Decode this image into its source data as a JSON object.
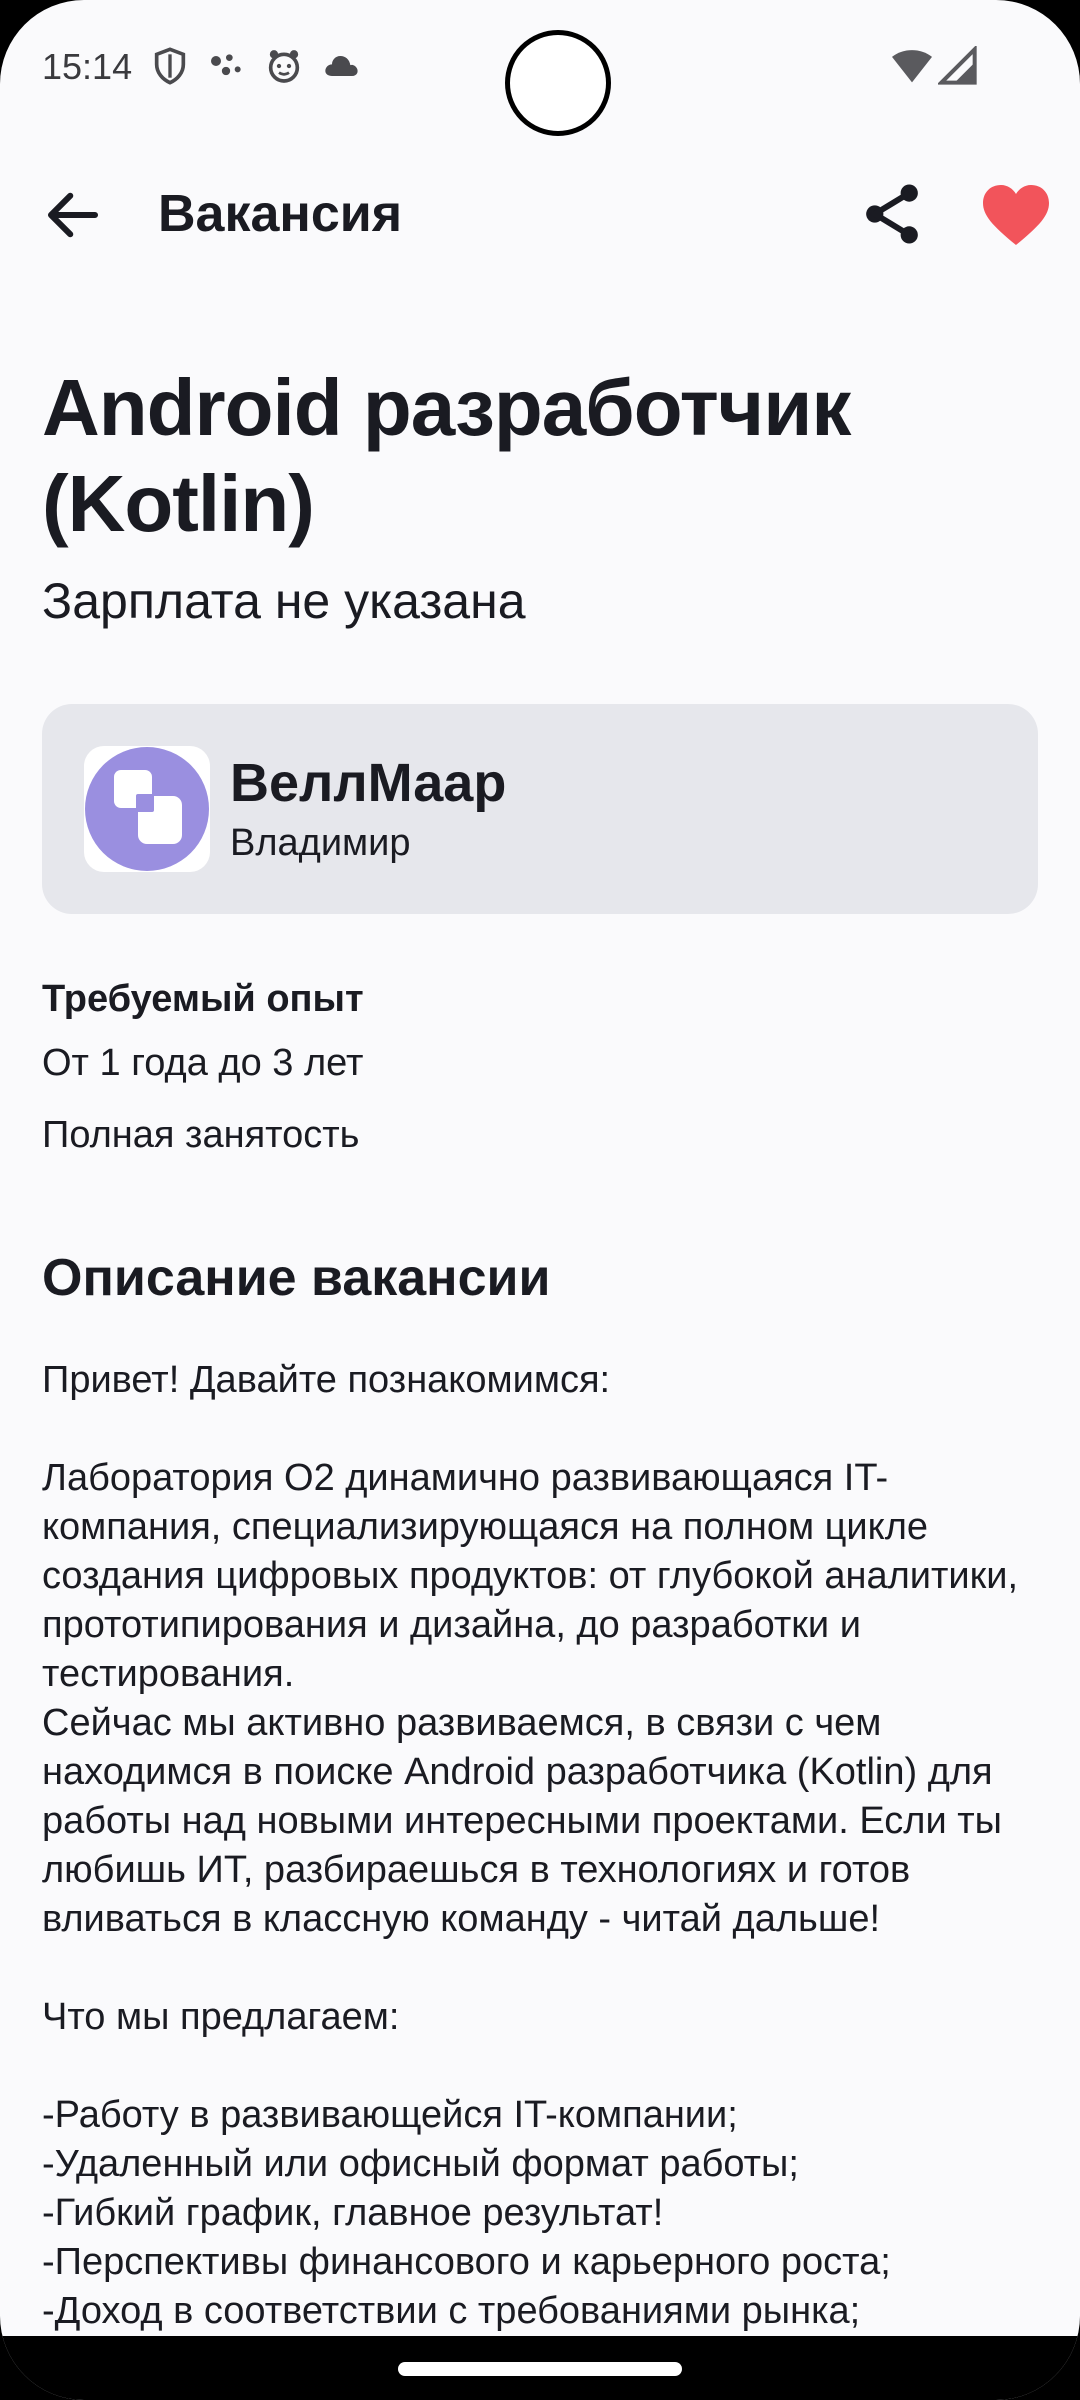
{
  "status_bar": {
    "time": "15:14",
    "icons": [
      "shield-icon",
      "assistant-dots-icon",
      "bear-face-icon",
      "cloud-icon",
      "wifi-icon",
      "signal-icon"
    ]
  },
  "top_bar": {
    "title": "Вакансия",
    "icons": [
      "back-arrow-icon",
      "share-icon",
      "heart-icon"
    ],
    "favorite_color": "#f2545b"
  },
  "vacancy": {
    "title": "Android разработчик (Kotlin)",
    "salary": "Зарплата не указана",
    "company": {
      "name": "ВеллМаар",
      "city": "Владимир",
      "logo_color": "#9a8fe0"
    },
    "experience_label": "Требуемый опыт",
    "experience_value": "От 1 года до 3 лет",
    "employment": "Полная занятость",
    "description_heading": "Описание вакансии",
    "description": "Привет! Давайте познакомимся:\n\nЛаборатория О2 динамично развивающаяся IT-компания, специализирующаяся на полном цикле создания цифровых продуктов: от глубокой аналитики, прототипирования и дизайна, до разработки и тестирования.\nСейчас мы активно развиваемся, в связи с чем находимся в поиске Android разработчика (Kotlin) для работы над новыми интересными проектами. Если ты любишь ИТ, разбираешься в технологиях и готов вливаться в классную команду - читай дальше!\n\nЧто мы предлагаем:\n\n-Работу в развивающейся IT-компании;\n-Удаленный или офисный формат работы;\n-Гибкий график, главное результат!\n-Перспективы финансового и карьерного роста;\n-Доход в соответствии с требованиями рынка;"
  }
}
